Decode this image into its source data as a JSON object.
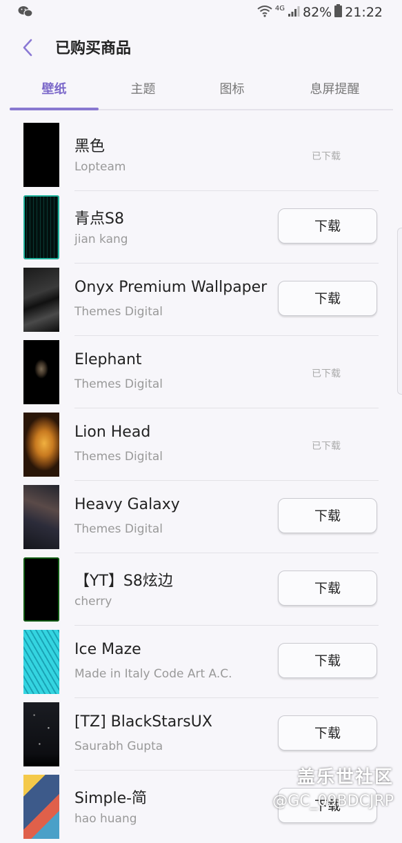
{
  "status_bar": {
    "network": "4G",
    "battery": "82%",
    "time": "21:22"
  },
  "header": {
    "title": "已购买商品"
  },
  "tabs": [
    {
      "label": "壁纸",
      "active": true
    },
    {
      "label": "主题",
      "active": false
    },
    {
      "label": "图标",
      "active": false
    },
    {
      "label": "息屏提醒",
      "active": false
    }
  ],
  "items": [
    {
      "title": "黑色",
      "author": "Lopteam",
      "state": "已下载"
    },
    {
      "title": "青点S8",
      "author": "jian kang",
      "button": "下载"
    },
    {
      "title": "Onyx Premium Wallpaper",
      "author": "Themes Digital",
      "button": "下载"
    },
    {
      "title": "Elephant",
      "author": "Themes Digital",
      "state": "已下载"
    },
    {
      "title": "Lion Head",
      "author": "Themes Digital",
      "state": "已下载"
    },
    {
      "title": "Heavy Galaxy",
      "author": "Themes Digital",
      "button": "下载"
    },
    {
      "title": "【YT】S8炫边",
      "author": "cherry",
      "button": "下载"
    },
    {
      "title": "Ice Maze",
      "author": "Made in Italy Code Art A.C.",
      "button": "下载"
    },
    {
      "title": "[TZ] BlackStarsUX",
      "author": "Saurabh Gupta",
      "button": "下载"
    },
    {
      "title": "Simple-简",
      "author": "hao huang",
      "button": "下载"
    }
  ],
  "watermark": {
    "site": "盖乐世社区",
    "handle": "@GC_09BDCJRP"
  },
  "colors": {
    "accent": "#7b68c9",
    "background": "#f7f6fa"
  }
}
